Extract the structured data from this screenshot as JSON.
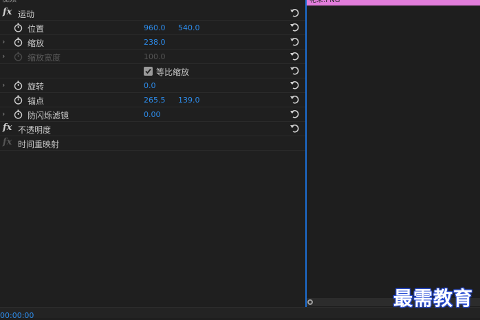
{
  "panel": {
    "section_label": "视频",
    "clip_name": "花朵.PNG",
    "timecode": "00:00:00"
  },
  "rows": [
    {
      "label": "运动"
    },
    {
      "label": "位置",
      "v1": "960.0",
      "v2": "540.0"
    },
    {
      "label": "缩放",
      "v1": "238.0"
    },
    {
      "label": "缩放宽度",
      "v1": "100.0"
    },
    {
      "label": "等比缩放"
    },
    {
      "label": "旋转",
      "v1": "0.0"
    },
    {
      "label": "锚点",
      "v1": "265.5",
      "v2": "139.0"
    },
    {
      "label": "防闪烁滤镜",
      "v1": "0.00"
    },
    {
      "label": "不透明度"
    },
    {
      "label": "时间重映射"
    }
  ],
  "fx_label": "fx",
  "watermark": "最需教育",
  "colors": {
    "accent": "#2d8ceb",
    "clip": "#e27ddb",
    "playhead": "#1d6fd6"
  }
}
